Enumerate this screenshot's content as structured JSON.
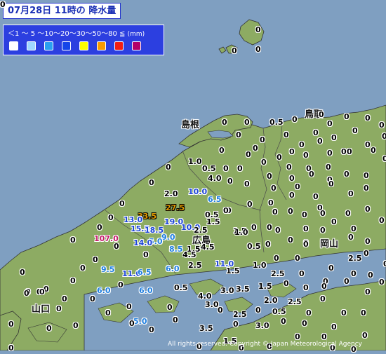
{
  "title": "07月28日 11時の 降水量",
  "legend": {
    "ranges": "＜1 ～ 5 ～10～20～30～50～80 ≦",
    "unit": "(mm)",
    "colors": [
      "#ffffff",
      "#9fd6ff",
      "#2aa0f0",
      "#1545e8",
      "#fcff00",
      "#f99b00",
      "#f31e12",
      "#b40068"
    ]
  },
  "places": {
    "shimane": "島根",
    "tottori": "鳥取",
    "hiroshima": "広島",
    "okayama": "岡山",
    "yamaguchi": "山口"
  },
  "credit": "All rights reserved. Copyright © Japan Meteorological Agency",
  "values": [
    "0",
    "0",
    "0",
    "0",
    "0",
    "0.5",
    "0",
    "0",
    "0",
    "0",
    "0",
    "0",
    "0",
    "0",
    "0",
    "0",
    "0",
    "0",
    "0",
    "0",
    "0",
    "0",
    "0",
    "0",
    "0",
    "0",
    "0",
    "0",
    "0",
    "0",
    "0",
    "0",
    "0",
    "0",
    "0",
    "0",
    "0",
    "1.0",
    "0.5",
    "0",
    "0",
    "0",
    "0",
    "0",
    "0",
    "0",
    "0",
    "0",
    "4.0",
    "0",
    "0",
    "0",
    "0",
    "0",
    "0",
    "0",
    "0",
    "0",
    "2.0",
    "10.0",
    "6.5",
    "0",
    "0",
    "0",
    "0",
    "0",
    "0",
    "0",
    "0",
    "27.5",
    "0.5",
    "0",
    "0",
    "0",
    "0",
    "0",
    "0",
    "0",
    "0",
    "33.5",
    "19.0",
    "1.5",
    "0",
    "0",
    "0",
    "0",
    "0",
    "0",
    "13.0",
    "15.5",
    "18.5",
    "10.0",
    "2.5",
    "1.5",
    "0",
    "0",
    "0",
    "0",
    "107.0",
    "9.0",
    "5.0",
    "4.5",
    "1.0",
    "0.5",
    "0",
    "0",
    "0",
    "0",
    "0",
    "14.0",
    "8.5",
    "1.5",
    "1.0",
    "0",
    "0",
    "0",
    "4.5",
    "2.5",
    "0",
    "0",
    "0",
    "0",
    "11.0",
    "1.5",
    "0",
    "0",
    "0",
    "0",
    "0",
    "9.5",
    "11.0",
    "6.5",
    "6.0",
    "2.5",
    "2.5",
    "0",
    "0",
    "0",
    "0",
    "0",
    "0",
    "6.0",
    "3.5",
    "1.5",
    "0",
    "0",
    "0",
    "0",
    "0",
    "0",
    "6.0",
    "0.5",
    "4.0",
    "3.0",
    "2.0",
    "2.5",
    "0",
    "0",
    "0",
    "0",
    "0",
    "0",
    "0",
    "3.0",
    "2.5",
    "0",
    "0",
    "0.5",
    "0",
    "0",
    "0",
    "0",
    "0",
    "0",
    "5.0",
    "0",
    "0",
    "0",
    "0",
    "0",
    "0",
    "0",
    "0",
    "0",
    "3.5",
    "1.5",
    "3.0",
    "0",
    "0",
    "0",
    "0",
    "0",
    "0",
    "0",
    "0",
    "0",
    "0",
    "0"
  ]
}
